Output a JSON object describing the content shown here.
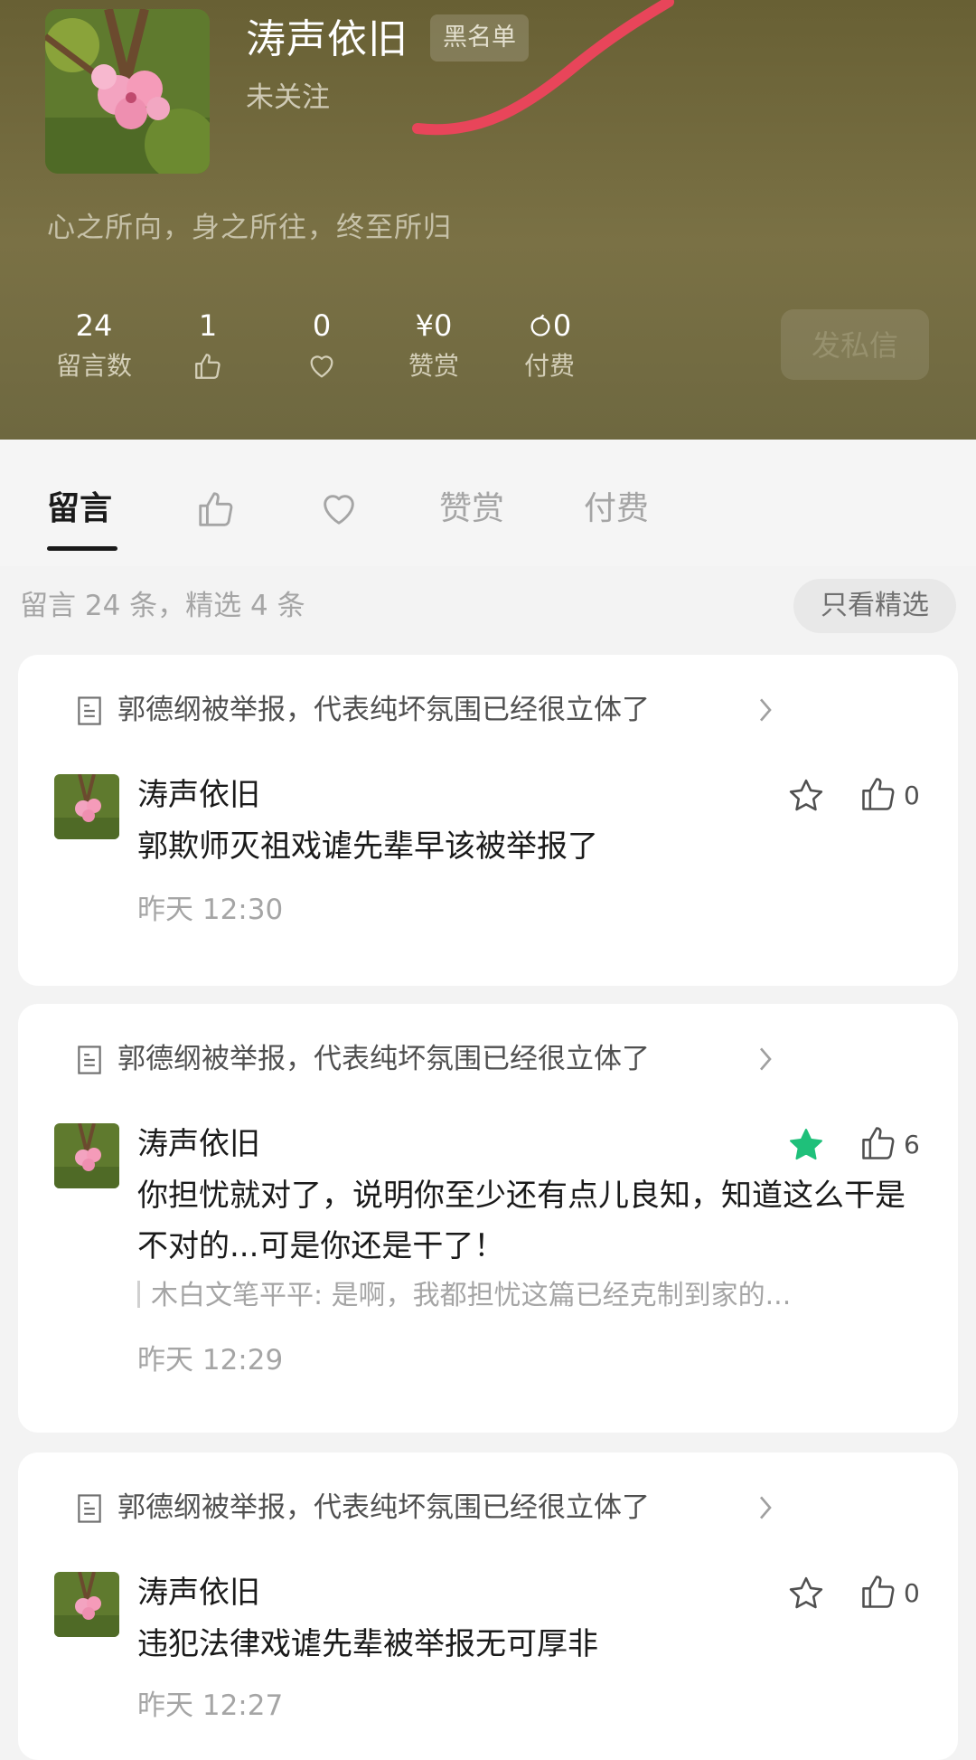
{
  "profile": {
    "name": "涛声依旧",
    "badge": "黑名单",
    "follow_status": "未关注",
    "bio": "心之所向，身之所往，终至所归",
    "stats": {
      "comments": {
        "value": "24",
        "label": "留言数"
      },
      "likes": {
        "value": "1"
      },
      "favorites": {
        "value": "0"
      },
      "rewards": {
        "value": "¥0",
        "label": "赞赏"
      },
      "paid": {
        "value": "0",
        "label": "付费"
      }
    },
    "dm_label": "发私信"
  },
  "tabs": {
    "comments": "留言",
    "rewards": "赞赏",
    "paid": "付费"
  },
  "summary": "留言 24 条，精选 4 条",
  "filter_label": "只看精选",
  "comments": [
    {
      "article": "郭德纲被举报，代表纯坏氛围已经很立体了",
      "user": "涛声依旧",
      "text": "郭欺师灭祖戏谑先辈早该被举报了",
      "time": "昨天 12:30",
      "starred": false,
      "likes": "0"
    },
    {
      "article": "郭德纲被举报，代表纯坏氛围已经很立体了",
      "user": "涛声依旧",
      "text": "你担忧就对了，说明你至少还有点儿良知，知道这么干是不对的...可是你还是干了！",
      "reply": "木白文笔平平: 是啊，我都担忧这篇已经克制到家的...",
      "time": "昨天 12:29",
      "starred": true,
      "likes": "6"
    },
    {
      "article": "郭德纲被举报，代表纯坏氛围已经很立体了",
      "user": "涛声依旧",
      "text": "违犯法律戏谑先辈被举报无可厚非",
      "time": "昨天 12:27",
      "starred": false,
      "likes": "0"
    }
  ],
  "colors": {
    "header_bg": "#6e6840",
    "star_active": "#1fc07a",
    "annotation_red": "#e8455a"
  }
}
